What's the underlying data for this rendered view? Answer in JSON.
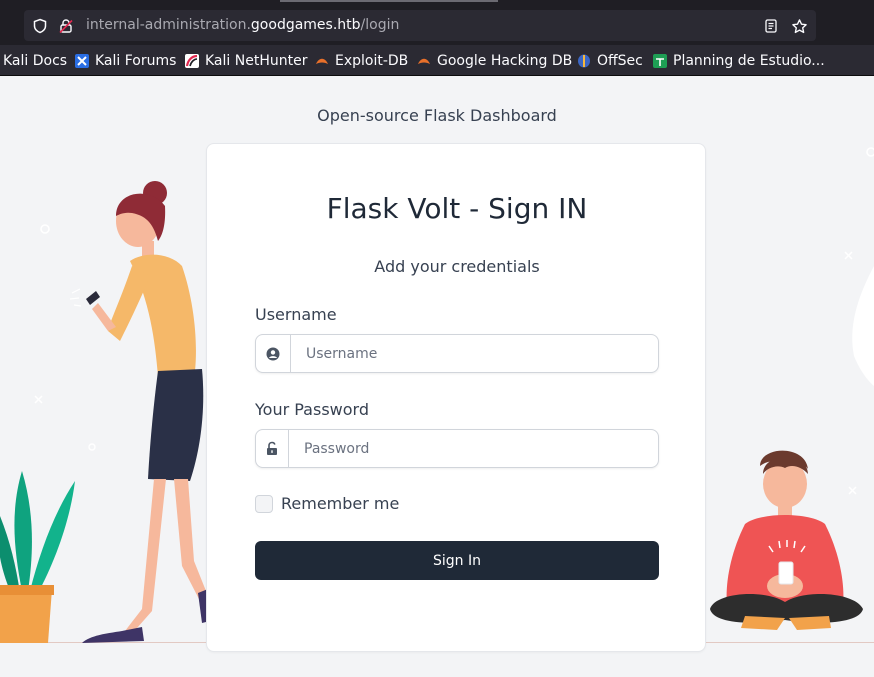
{
  "browser": {
    "url_prefix": "internal-administration.",
    "url_host": "goodgames.htb",
    "url_path": "/login",
    "bookmarks": [
      {
        "label": "Kali Docs",
        "icon": "kali-docs-icon"
      },
      {
        "label": "Kali Forums",
        "icon": "kali-forums-icon"
      },
      {
        "label": "Kali NetHunter",
        "icon": "kali-nethunter-icon"
      },
      {
        "label": "Exploit-DB",
        "icon": "exploit-db-icon"
      },
      {
        "label": "Google Hacking DB",
        "icon": "ghdb-icon"
      },
      {
        "label": "OffSec",
        "icon": "offsec-icon"
      },
      {
        "label": "Planning de Estudio...",
        "icon": "sheets-icon"
      }
    ]
  },
  "page": {
    "tagline": "Open-source Flask Dashboard"
  },
  "login": {
    "title": "Flask Volt - Sign IN",
    "subtitle": "Add your credentials",
    "username_label": "Username",
    "username_placeholder": "Username",
    "password_label": "Your Password",
    "password_placeholder": "Password",
    "remember_label": "Remember me",
    "submit_label": "Sign In"
  },
  "colors": {
    "primary_button": "#1f2937",
    "page_background": "#f3f4f6",
    "chrome_background": "#2b2a33"
  }
}
